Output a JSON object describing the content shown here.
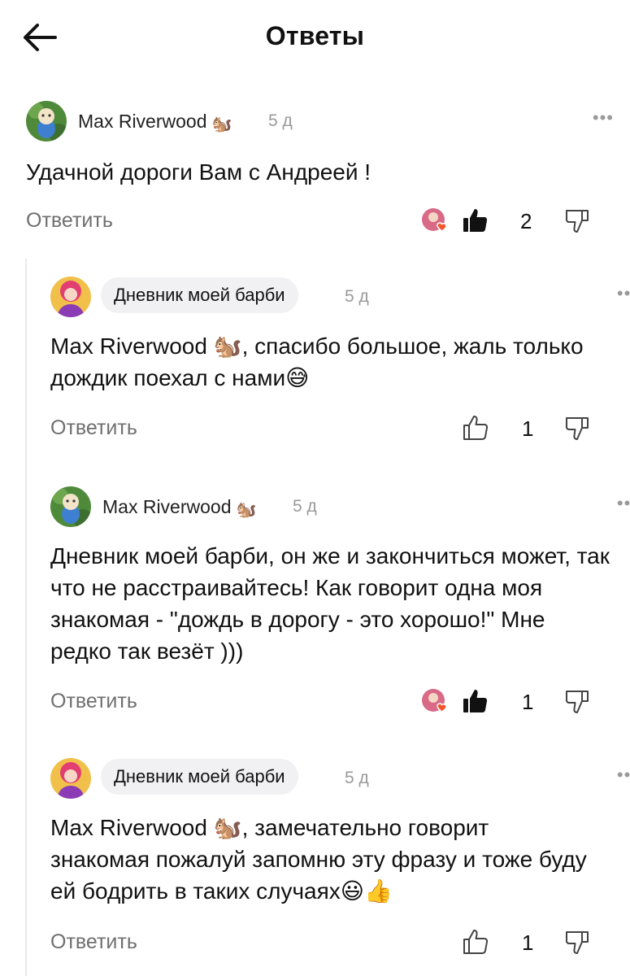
{
  "header": {
    "title": "Ответы",
    "back_icon": "arrow-left-icon"
  },
  "comments": [
    {
      "author": "Max Riverwood",
      "author_badge": "🐿️",
      "time": "5 д",
      "text": "Удачной дороги Вам с Андреей !",
      "reply_label": "Ответить",
      "likes": "2",
      "liked": true
    },
    {
      "author": "Дневник моей барби",
      "time": "5 д",
      "text": "Max Riverwood 🐿️, спасибо большое, жаль только дождик поехал с нами😅",
      "reply_label": "Ответить",
      "likes": "1",
      "liked": false
    },
    {
      "author": "Max Riverwood",
      "author_badge": "🐿️",
      "time": "5 д",
      "text": "Дневник моей барби, он же и закончиться может, так что не расстраивайтесь! Как говорит одна моя знакомая - \"дождь в дорогу - это хорошо!\" Мне редко так везёт )))",
      "reply_label": "Ответить",
      "likes": "1",
      "liked": true
    },
    {
      "author": "Дневник моей барби",
      "time": "5 д",
      "text": "Max Riverwood 🐿️, замечательно говорит знакомая пожалуй запомню эту фразу и тоже буду ей бодрить в таких случаях😃👍",
      "reply_label": "Ответить",
      "likes": "1",
      "liked": false
    }
  ],
  "more_label": "•••",
  "colors": {
    "muted": "#6f6f6f",
    "pill": "#f1f1f3",
    "heart": "#f2552c"
  }
}
